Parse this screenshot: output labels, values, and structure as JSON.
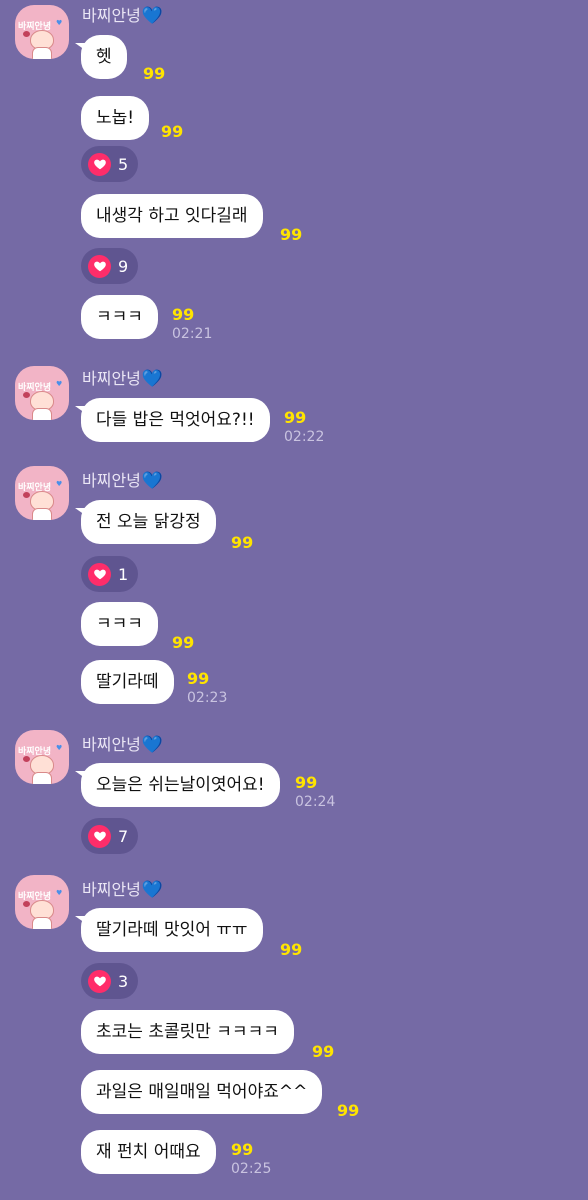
{
  "sender_name": "바찌안녕",
  "sender_emoji": "💙",
  "avatar_label": "바찌안녕",
  "groups": [
    {
      "messages": [
        {
          "text": "헷",
          "unread": "99"
        },
        {
          "text": "노놉!",
          "unread": "99",
          "reaction": {
            "icon": "heart-icon",
            "count": "5"
          }
        },
        {
          "text": "내생각 하고 잇다길래",
          "unread": "99",
          "reaction": {
            "icon": "heart-icon",
            "count": "9"
          }
        },
        {
          "text": "ㅋㅋㅋ",
          "unread": "99",
          "time": "02:21"
        }
      ]
    },
    {
      "messages": [
        {
          "text": "다들 밥은 먹엇어요?!!",
          "unread": "99",
          "time": "02:22"
        }
      ]
    },
    {
      "messages": [
        {
          "text": "전 오늘 닭강정",
          "unread": "99",
          "reaction": {
            "icon": "heart-icon",
            "count": "1"
          }
        },
        {
          "text": "ㅋㅋㅋ",
          "unread": "99"
        },
        {
          "text": "딸기라떼",
          "unread": "99",
          "time": "02:23"
        }
      ]
    },
    {
      "messages": [
        {
          "text": "오늘은 쉬는날이엿어요!",
          "unread": "99",
          "time": "02:24",
          "reaction": {
            "icon": "heart-icon",
            "count": "7"
          }
        }
      ]
    },
    {
      "messages": [
        {
          "text": "딸기라떼 맛잇어 ㅠㅠ",
          "unread": "99",
          "reaction": {
            "icon": "heart-icon",
            "count": "3"
          }
        },
        {
          "text": "초코는 초콜릿만 ㅋㅋㅋㅋ",
          "unread": "99"
        },
        {
          "text": "과일은 매일매일 먹어야죠^^",
          "unread": "99"
        },
        {
          "text": "재 펀치 어때요",
          "unread": "99",
          "time": "02:25"
        }
      ]
    }
  ],
  "colors": {
    "background": "#756aa5",
    "bubble": "#ffffff",
    "unread": "#ffe400",
    "reaction_heart": "#ff2d6a"
  }
}
